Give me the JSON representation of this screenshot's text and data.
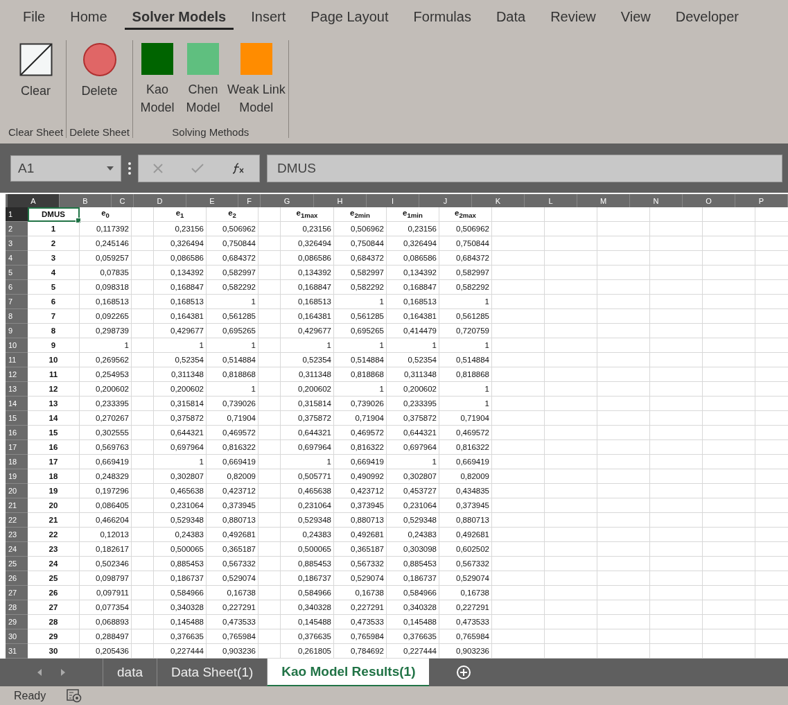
{
  "ribbon_tabs": [
    {
      "label": "File",
      "selected": false
    },
    {
      "label": "Home",
      "selected": false
    },
    {
      "label": "Solver Models",
      "selected": true
    },
    {
      "label": "Insert",
      "selected": false
    },
    {
      "label": "Page Layout",
      "selected": false
    },
    {
      "label": "Formulas",
      "selected": false
    },
    {
      "label": "Data",
      "selected": false
    },
    {
      "label": "Review",
      "selected": false
    },
    {
      "label": "View",
      "selected": false
    },
    {
      "label": "Developer",
      "selected": false
    }
  ],
  "ribbon_groups": [
    {
      "label": "Clear Sheet",
      "buttons": [
        {
          "kind": "sheet",
          "label": "Clear"
        }
      ]
    },
    {
      "label": "Delete Sheet",
      "buttons": [
        {
          "kind": "circle",
          "label": "Delete",
          "color": "#e06666"
        }
      ]
    },
    {
      "label": "Solving Methods",
      "buttons": [
        {
          "kind": "square",
          "label": "Kao\nModel",
          "color": "#006400"
        },
        {
          "kind": "square",
          "label": "Chen\nModel",
          "color": "#5fbf7f"
        },
        {
          "kind": "square",
          "label": "Weak Link\nModel",
          "color": "#ff8c00"
        }
      ]
    }
  ],
  "name_box": "A1",
  "formula": "DMUS",
  "columns": [
    {
      "letter": "A",
      "kind": "data",
      "selected": true
    },
    {
      "letter": "B",
      "kind": "data",
      "selected": false
    },
    {
      "letter": "C",
      "kind": "gap",
      "selected": false
    },
    {
      "letter": "D",
      "kind": "data",
      "selected": false
    },
    {
      "letter": "E",
      "kind": "data",
      "selected": false
    },
    {
      "letter": "F",
      "kind": "gap",
      "selected": false
    },
    {
      "letter": "G",
      "kind": "data",
      "selected": false
    },
    {
      "letter": "H",
      "kind": "data",
      "selected": false
    },
    {
      "letter": "I",
      "kind": "data",
      "selected": false
    },
    {
      "letter": "J",
      "kind": "data",
      "selected": false
    },
    {
      "letter": "K",
      "kind": "empty",
      "selected": false
    },
    {
      "letter": "L",
      "kind": "empty",
      "selected": false
    },
    {
      "letter": "M",
      "kind": "empty",
      "selected": false
    },
    {
      "letter": "N",
      "kind": "empty",
      "selected": false
    },
    {
      "letter": "O",
      "kind": "empty",
      "selected": false
    },
    {
      "letter": "P",
      "kind": "empty",
      "selected": false
    }
  ],
  "rows": [
    {
      "n": "1",
      "kind": "header",
      "selected": true,
      "cells": [
        "DMUS",
        "e$_{0}$",
        "e$_{1}$",
        "e$_{2}$",
        "e$_{1max}$",
        "e$_{2min}$",
        "e$_{1min}$",
        "e$_{2max}$"
      ]
    },
    {
      "n": "2",
      "kind": "data",
      "selected": false,
      "cells": [
        "1",
        "0,117392",
        "0,23156",
        "0,506962",
        "0,23156",
        "0,506962",
        "0,23156",
        "0,506962"
      ]
    },
    {
      "n": "3",
      "kind": "data",
      "selected": false,
      "cells": [
        "2",
        "0,245146",
        "0,326494",
        "0,750844",
        "0,326494",
        "0,750844",
        "0,326494",
        "0,750844"
      ]
    },
    {
      "n": "4",
      "kind": "data",
      "selected": false,
      "cells": [
        "3",
        "0,059257",
        "0,086586",
        "0,684372",
        "0,086586",
        "0,684372",
        "0,086586",
        "0,684372"
      ]
    },
    {
      "n": "5",
      "kind": "data",
      "selected": false,
      "cells": [
        "4",
        "0,07835",
        "0,134392",
        "0,582997",
        "0,134392",
        "0,582997",
        "0,134392",
        "0,582997"
      ]
    },
    {
      "n": "6",
      "kind": "data",
      "selected": false,
      "cells": [
        "5",
        "0,098318",
        "0,168847",
        "0,582292",
        "0,168847",
        "0,582292",
        "0,168847",
        "0,582292"
      ]
    },
    {
      "n": "7",
      "kind": "data",
      "selected": false,
      "cells": [
        "6",
        "0,168513",
        "0,168513",
        "1",
        "0,168513",
        "1",
        "0,168513",
        "1"
      ]
    },
    {
      "n": "8",
      "kind": "data",
      "selected": false,
      "cells": [
        "7",
        "0,092265",
        "0,164381",
        "0,561285",
        "0,164381",
        "0,561285",
        "0,164381",
        "0,561285"
      ]
    },
    {
      "n": "9",
      "kind": "data",
      "selected": false,
      "cells": [
        "8",
        "0,298739",
        "0,429677",
        "0,695265",
        "0,429677",
        "0,695265",
        "0,414479",
        "0,720759"
      ]
    },
    {
      "n": "10",
      "kind": "data",
      "selected": false,
      "cells": [
        "9",
        "1",
        "1",
        "1",
        "1",
        "1",
        "1",
        "1"
      ]
    },
    {
      "n": "11",
      "kind": "data",
      "selected": false,
      "cells": [
        "10",
        "0,269562",
        "0,52354",
        "0,514884",
        "0,52354",
        "0,514884",
        "0,52354",
        "0,514884"
      ]
    },
    {
      "n": "12",
      "kind": "data",
      "selected": false,
      "cells": [
        "11",
        "0,254953",
        "0,311348",
        "0,818868",
        "0,311348",
        "0,818868",
        "0,311348",
        "0,818868"
      ]
    },
    {
      "n": "13",
      "kind": "data",
      "selected": false,
      "cells": [
        "12",
        "0,200602",
        "0,200602",
        "1",
        "0,200602",
        "1",
        "0,200602",
        "1"
      ]
    },
    {
      "n": "14",
      "kind": "data",
      "selected": false,
      "cells": [
        "13",
        "0,233395",
        "0,315814",
        "0,739026",
        "0,315814",
        "0,739026",
        "0,233395",
        "1"
      ]
    },
    {
      "n": "15",
      "kind": "data",
      "selected": false,
      "cells": [
        "14",
        "0,270267",
        "0,375872",
        "0,71904",
        "0,375872",
        "0,71904",
        "0,375872",
        "0,71904"
      ]
    },
    {
      "n": "16",
      "kind": "data",
      "selected": false,
      "cells": [
        "15",
        "0,302555",
        "0,644321",
        "0,469572",
        "0,644321",
        "0,469572",
        "0,644321",
        "0,469572"
      ]
    },
    {
      "n": "17",
      "kind": "data",
      "selected": false,
      "cells": [
        "16",
        "0,569763",
        "0,697964",
        "0,816322",
        "0,697964",
        "0,816322",
        "0,697964",
        "0,816322"
      ]
    },
    {
      "n": "18",
      "kind": "data",
      "selected": false,
      "cells": [
        "17",
        "0,669419",
        "1",
        "0,669419",
        "1",
        "0,669419",
        "1",
        "0,669419"
      ]
    },
    {
      "n": "19",
      "kind": "data",
      "selected": false,
      "cells": [
        "18",
        "0,248329",
        "0,302807",
        "0,82009",
        "0,505771",
        "0,490992",
        "0,302807",
        "0,82009"
      ]
    },
    {
      "n": "20",
      "kind": "data",
      "selected": false,
      "cells": [
        "19",
        "0,197296",
        "0,465638",
        "0,423712",
        "0,465638",
        "0,423712",
        "0,453727",
        "0,434835"
      ]
    },
    {
      "n": "21",
      "kind": "data",
      "selected": false,
      "cells": [
        "20",
        "0,086405",
        "0,231064",
        "0,373945",
        "0,231064",
        "0,373945",
        "0,231064",
        "0,373945"
      ]
    },
    {
      "n": "22",
      "kind": "data",
      "selected": false,
      "cells": [
        "21",
        "0,466204",
        "0,529348",
        "0,880713",
        "0,529348",
        "0,880713",
        "0,529348",
        "0,880713"
      ]
    },
    {
      "n": "23",
      "kind": "data",
      "selected": false,
      "cells": [
        "22",
        "0,12013",
        "0,24383",
        "0,492681",
        "0,24383",
        "0,492681",
        "0,24383",
        "0,492681"
      ]
    },
    {
      "n": "24",
      "kind": "data",
      "selected": false,
      "cells": [
        "23",
        "0,182617",
        "0,500065",
        "0,365187",
        "0,500065",
        "0,365187",
        "0,303098",
        "0,602502"
      ]
    },
    {
      "n": "25",
      "kind": "data",
      "selected": false,
      "cells": [
        "24",
        "0,502346",
        "0,885453",
        "0,567332",
        "0,885453",
        "0,567332",
        "0,885453",
        "0,567332"
      ]
    },
    {
      "n": "26",
      "kind": "data",
      "selected": false,
      "cells": [
        "25",
        "0,098797",
        "0,186737",
        "0,529074",
        "0,186737",
        "0,529074",
        "0,186737",
        "0,529074"
      ]
    },
    {
      "n": "27",
      "kind": "data",
      "selected": false,
      "cells": [
        "26",
        "0,097911",
        "0,584966",
        "0,16738",
        "0,584966",
        "0,16738",
        "0,584966",
        "0,16738"
      ]
    },
    {
      "n": "28",
      "kind": "data",
      "selected": false,
      "cells": [
        "27",
        "0,077354",
        "0,340328",
        "0,227291",
        "0,340328",
        "0,227291",
        "0,340328",
        "0,227291"
      ]
    },
    {
      "n": "29",
      "kind": "data",
      "selected": false,
      "cells": [
        "28",
        "0,068893",
        "0,145488",
        "0,473533",
        "0,145488",
        "0,473533",
        "0,145488",
        "0,473533"
      ]
    },
    {
      "n": "30",
      "kind": "data",
      "selected": false,
      "cells": [
        "29",
        "0,288497",
        "0,376635",
        "0,765984",
        "0,376635",
        "0,765984",
        "0,376635",
        "0,765984"
      ]
    },
    {
      "n": "31",
      "kind": "data",
      "selected": false,
      "cells": [
        "30",
        "0,205436",
        "0,227444",
        "0,903236",
        "0,261805",
        "0,784692",
        "0,227444",
        "0,903236"
      ]
    }
  ],
  "sheet_tabs": [
    {
      "label": "data",
      "selected": false
    },
    {
      "label": "Data Sheet(1)",
      "selected": false
    },
    {
      "label": "Kao Model Results(1)",
      "selected": true
    }
  ],
  "status": "Ready"
}
